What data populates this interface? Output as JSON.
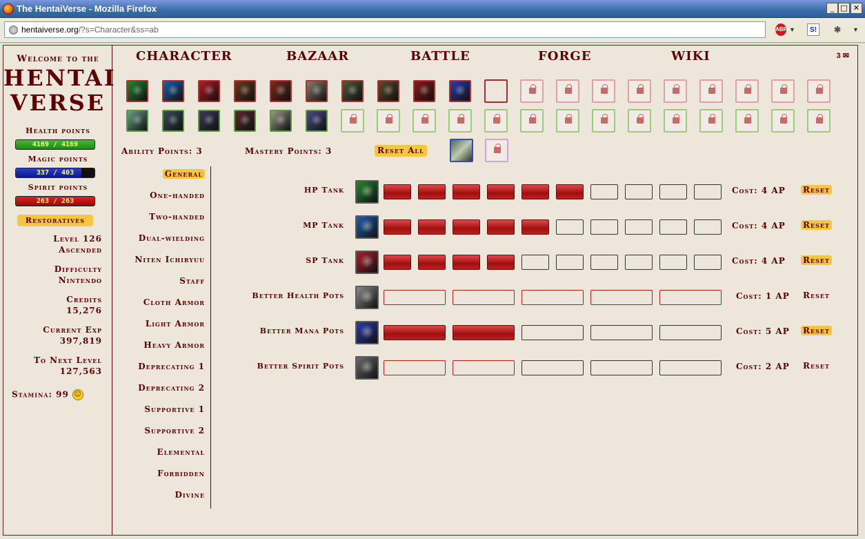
{
  "window": {
    "title": "The HentaiVerse - Mozilla Firefox",
    "minimize": "_",
    "maximize": "□",
    "close": "✕"
  },
  "browser": {
    "url_host": "hentaiverse.org",
    "url_rest": "/?s=Character&ss=ab",
    "abp_label": "ABP",
    "si_label": "S!"
  },
  "sidebar": {
    "welcome": "Welcome to the",
    "logo_line1": "HENTAI",
    "logo_line2": "VERSE",
    "health_label": "Health points",
    "health_value": "4169 / 4169",
    "magic_label": "Magic points",
    "magic_value": "337 / 403",
    "magic_fraction": 0.836,
    "spirit_label": "Spirit points",
    "spirit_value": "263 / 263",
    "restoratives": "Restoratives",
    "level_line1": "Level 126",
    "level_line2": "Ascended",
    "difficulty_label": "Difficulty",
    "difficulty_value": "Nintendo",
    "credits_label": "Credits",
    "credits_value": "15,276",
    "exp_label": "Current Exp",
    "exp_value": "397,819",
    "next_label": "To Next Level",
    "next_value": "127,563",
    "stamina": "Stamina: 99",
    "stamina_icon": "smile-icon"
  },
  "menu": {
    "items": [
      "CHARACTER",
      "BAZAAR",
      "BATTLE",
      "FORGE",
      "WIKI"
    ],
    "mail_count": "3",
    "mail_icon": "envelope-icon"
  },
  "abilities": {
    "row1_colors": [
      "#1e8a2a",
      "#1b5fb0",
      "#b01c2a",
      "#6a3a1a",
      "#7a2a1a",
      "#8a7a6a",
      "#4a5a3a",
      "#5a4a2a",
      "#8a1a1a",
      "#2a3ab0"
    ],
    "row2_colors": [
      "#6aa08a",
      "#3a4a5a",
      "#3a3a5a",
      "#5a2a2a",
      "#9a9a8a",
      "#4a4a8a"
    ],
    "ability_points": "Ability Points: 3",
    "mastery_points": "Mastery Points: 3",
    "reset_all": "Reset All"
  },
  "categories": [
    "General",
    "One-handed",
    "Two-handed",
    "Dual-wielding",
    "Niten Ichiryuu",
    "Staff",
    "Cloth Armor",
    "Light Armor",
    "Heavy Armor",
    "Deprecating 1",
    "Deprecating 2",
    "Supportive 1",
    "Supportive 2",
    "Elemental",
    "Forbidden",
    "Divine"
  ],
  "selected_category": "General",
  "training": [
    {
      "name": "HP Tank",
      "icon_color": "#1e8a2a",
      "filled": 6,
      "total": 10,
      "red_empty": 0,
      "cost": "Cost: 4 AP",
      "reset": "Reset",
      "reset_active": true,
      "wide": false
    },
    {
      "name": "MP Tank",
      "icon_color": "#1b5fb0",
      "filled": 5,
      "total": 10,
      "red_empty": 0,
      "cost": "Cost: 4 AP",
      "reset": "Reset",
      "reset_active": true,
      "wide": false
    },
    {
      "name": "SP Tank",
      "icon_color": "#b01c2a",
      "filled": 4,
      "total": 10,
      "red_empty": 0,
      "cost": "Cost: 4 AP",
      "reset": "Reset",
      "reset_active": true,
      "wide": false
    },
    {
      "name": "Better Health Pots",
      "icon_color": "#8a8a8a",
      "filled": 0,
      "total": 5,
      "red_empty": 5,
      "cost": "Cost: 1 AP",
      "reset": "Reset",
      "reset_active": false,
      "wide": true
    },
    {
      "name": "Better Mana Pots",
      "icon_color": "#2a3ab0",
      "filled": 2,
      "total": 5,
      "red_empty": 0,
      "cost": "Cost: 5 AP",
      "reset": "Reset",
      "reset_active": true,
      "wide": true
    },
    {
      "name": "Better Spirit Pots",
      "icon_color": "#6a6a6a",
      "filled": 0,
      "total": 5,
      "red_empty": 2,
      "cost": "Cost: 2 AP",
      "reset": "Reset",
      "reset_active": false,
      "wide": true
    }
  ]
}
